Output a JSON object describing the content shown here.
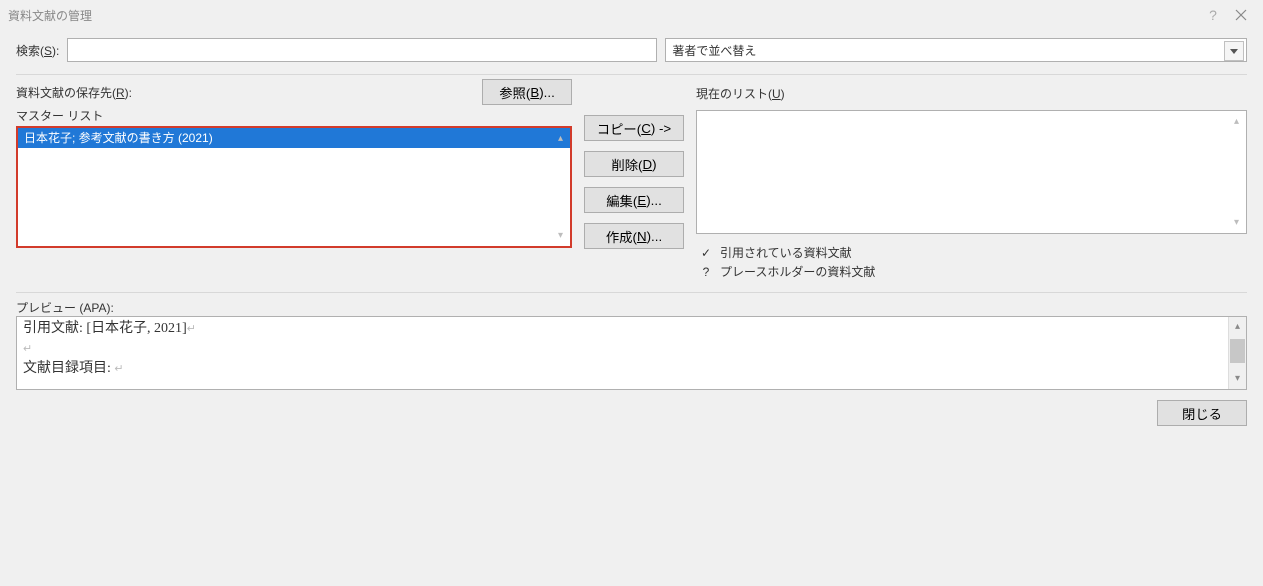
{
  "title": "資料文献の管理",
  "search": {
    "label_pre": "検索(",
    "label_key": "S",
    "label_post": "):",
    "value": ""
  },
  "sort": {
    "selected": "著者で並べ替え"
  },
  "save_location": {
    "label_pre": "資料文献の保存先(",
    "label_key": "R",
    "label_post": "):"
  },
  "master_list_label": "マスター リスト",
  "master_list_items": [
    "日本花子; 参考文献の書き方 (2021)"
  ],
  "browse_btn": {
    "pre": "参照(",
    "key": "B",
    "post": ")..."
  },
  "copy_btn": {
    "pre": "コピー(",
    "key": "C",
    "post": ") ->"
  },
  "delete_btn": {
    "pre": "削除(",
    "key": "D",
    "post": ")"
  },
  "edit_btn": {
    "pre": "編集(",
    "key": "E",
    "post": ")..."
  },
  "new_btn": {
    "pre": "作成(",
    "key": "N",
    "post": ")..."
  },
  "current_list_label": {
    "pre": "現在のリスト(",
    "key": "U",
    "post": ")"
  },
  "legend": {
    "cited": "引用されている資料文献",
    "placeholder": "プレースホルダーの資料文献"
  },
  "preview_label": "プレビュー (APA):",
  "preview": {
    "line1_pre": "引用文献:   [",
    "line1_mid": "日本花子, 2021",
    "line1_post": "]",
    "line2": "",
    "line3": "文献目録項目:  "
  },
  "close_btn": "閉じる"
}
